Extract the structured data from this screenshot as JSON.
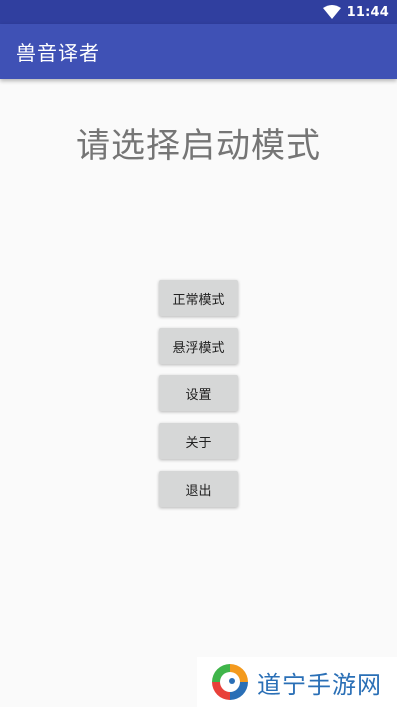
{
  "status_bar": {
    "time": "11:44",
    "icons": [
      "wifi-icon"
    ]
  },
  "app_bar": {
    "title": "兽音译者",
    "background": "#3f51b5",
    "status_background": "#303f9f"
  },
  "main": {
    "prompt": "请选择启动模式",
    "buttons": [
      {
        "label": "正常模式"
      },
      {
        "label": "悬浮模式"
      },
      {
        "label": "设置"
      },
      {
        "label": "关于"
      },
      {
        "label": "退出"
      }
    ]
  },
  "watermark": {
    "text": "道宁手游网",
    "icon": "swirl-logo-icon",
    "color": "#2a6fb6"
  }
}
